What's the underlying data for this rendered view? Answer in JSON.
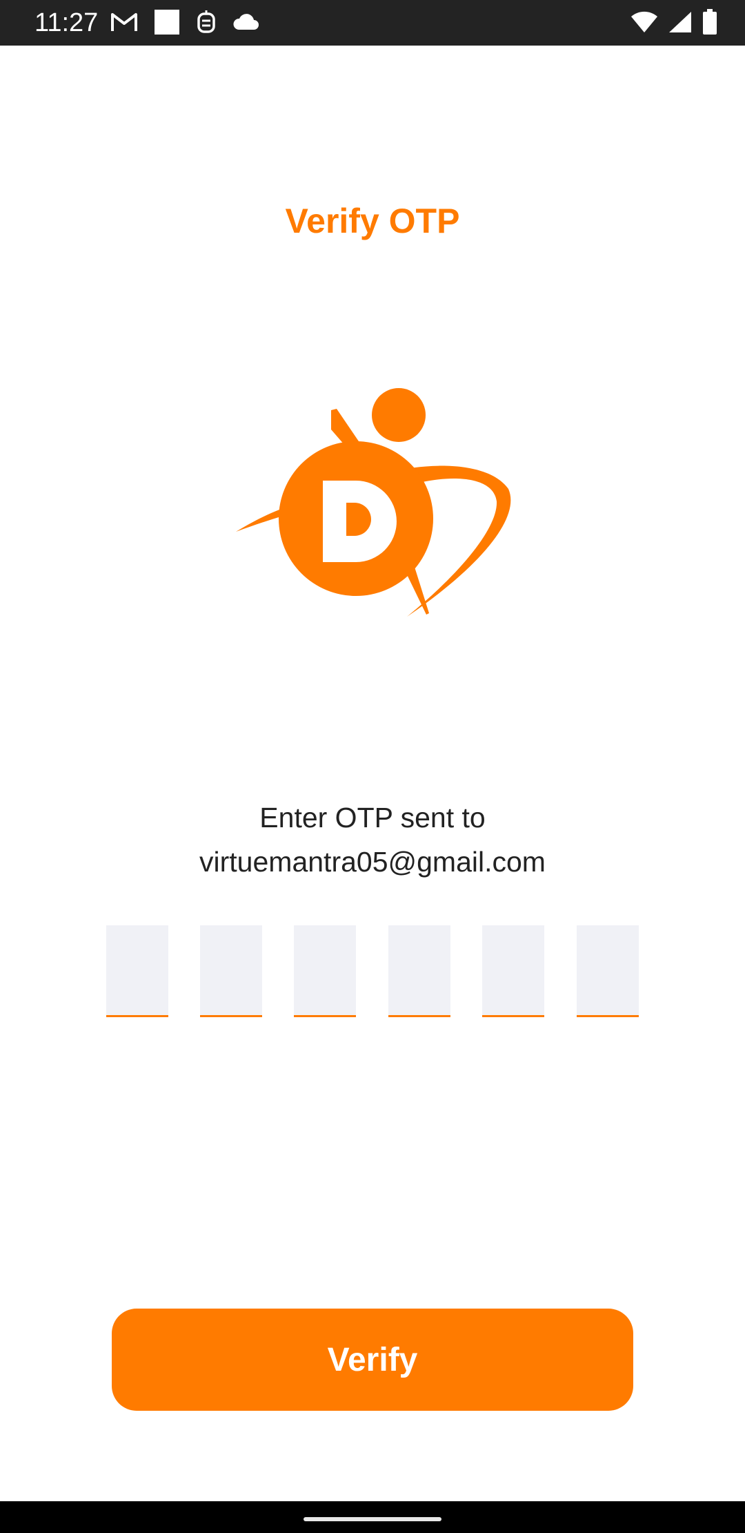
{
  "status_bar": {
    "time": "11:27",
    "left_icons": [
      "gmail-icon",
      "notification-square-icon",
      "assistant-icon",
      "cloud-icon"
    ],
    "right_icons": [
      "wifi-icon",
      "signal-icon",
      "battery-icon"
    ]
  },
  "title": "Verify OTP",
  "logo": {
    "letter": "D"
  },
  "instruction": {
    "line1": "Enter OTP sent to",
    "line2": "virtuemantra05@gmail.com"
  },
  "otp": {
    "digits": [
      "",
      "",
      "",
      "",
      "",
      ""
    ]
  },
  "verify_button": {
    "label": "Verify"
  },
  "colors": {
    "accent": "#ff7b00",
    "status_bar": "#232323",
    "otp_box_bg": "#f0f1f6",
    "text": "#222222"
  }
}
